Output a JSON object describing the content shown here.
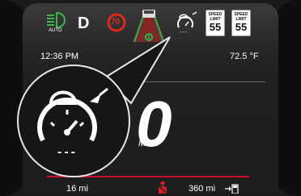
{
  "status_bar": {
    "headlight_label": "AUTO",
    "gear": "D",
    "speed_warning_value": "70",
    "acc_speed_display": "---",
    "speed_limit_1": {
      "header": "SPEED\nLIMIT",
      "value": "55"
    },
    "speed_limit_2": {
      "header": "SPEED\nLIMIT",
      "value": "55"
    }
  },
  "info_row": {
    "time": "12:36 PM",
    "temperature": "72.5 °F"
  },
  "speedometer": {
    "digits": "0",
    "unit": "MPH"
  },
  "callout": {
    "acc_speed_display": "---"
  },
  "bottom_bar": {
    "trip_distance": "16 mi",
    "range": "360 mi"
  },
  "colors": {
    "headlight_green": "#39b54a",
    "speed_warning_red": "#e0261b",
    "lane_green": "#29b34a",
    "alert_red": "#d41f26"
  },
  "icons": {
    "headlight": "auto-headlight-icon",
    "speed_warning": "speed-warning-icon",
    "lane_assist": "lane-assist-icon",
    "adaptive_cruise": "adaptive-cruise-icon",
    "seatbelt": "seatbelt-icon",
    "fuel": "fuel-pump-icon"
  }
}
